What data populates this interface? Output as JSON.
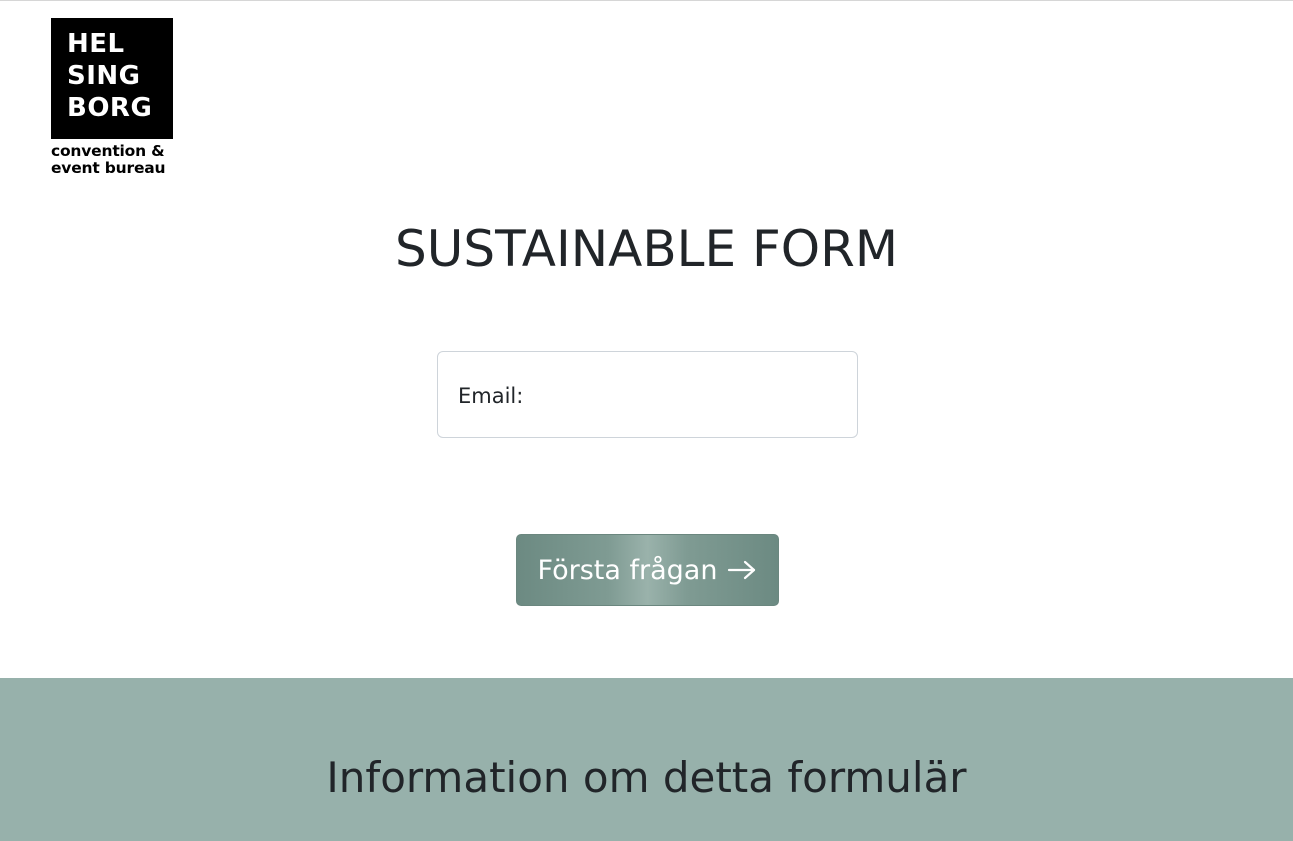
{
  "logo": {
    "line1": "HEL",
    "line2": "SING",
    "line3": "BORG",
    "sub1": "convention &",
    "sub2": "event bureau"
  },
  "title": "SUSTAINABLE FORM",
  "email": {
    "label": "Email:",
    "value": ""
  },
  "next_button": {
    "label": "Första frågan",
    "icon": "arrow-right-icon"
  },
  "info": {
    "title": "Information om detta formulär"
  },
  "colors": {
    "accent": "#97b1ab",
    "button": "#7f9b93",
    "text": "#212529"
  }
}
